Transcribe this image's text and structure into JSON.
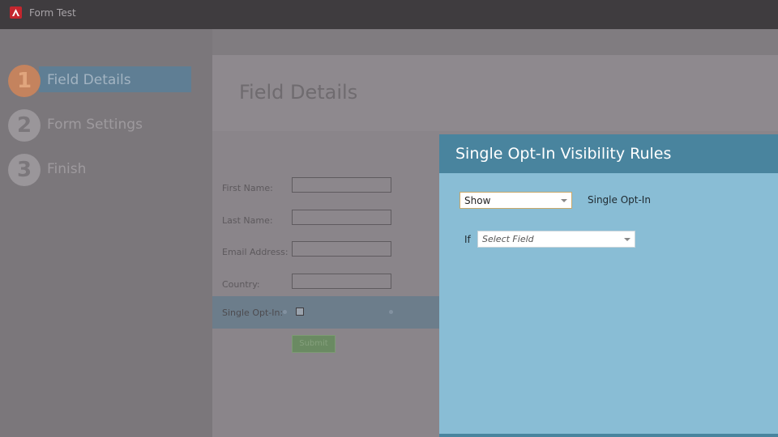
{
  "window": {
    "title": "Form Test"
  },
  "wizard": {
    "steps": [
      {
        "number": "1",
        "label": "Field Details"
      },
      {
        "number": "2",
        "label": "Form Settings"
      },
      {
        "number": "3",
        "label": "Finish"
      }
    ]
  },
  "page": {
    "title": "Field Details"
  },
  "form": {
    "fields": [
      {
        "label": "First Name:"
      },
      {
        "label": "Last Name:"
      },
      {
        "label": "Email Address:"
      },
      {
        "label": "Country:"
      }
    ],
    "optin_label": "Single Opt-In:",
    "submit_label": "Submit"
  },
  "modal": {
    "title": "Single Opt-In Visibility Rules",
    "visibility_select": "Show",
    "field_name": "Single Opt-In",
    "if_label": "If",
    "field_select_placeholder": "Select Field"
  },
  "colors": {
    "modal_header": "#49849e",
    "modal_body": "#89bdd5",
    "active_step": "#c4835e"
  }
}
